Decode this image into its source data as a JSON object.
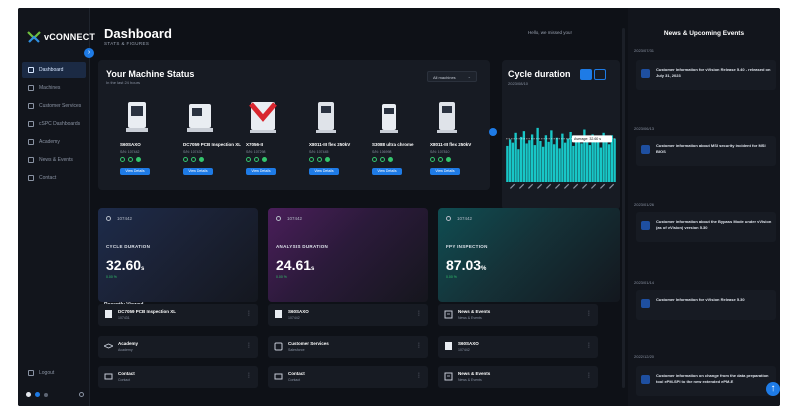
{
  "app": {
    "logo": "vCONNECT"
  },
  "header": {
    "title": "Dashboard",
    "subtitle": "STATS & FIGURES",
    "greeting": "Hello, we missed you!"
  },
  "sidebar": {
    "items": [
      {
        "label": "Dashboard",
        "icon": "grid-icon",
        "active": true
      },
      {
        "label": "Machines",
        "icon": "machine-icon"
      },
      {
        "label": "Customer Services",
        "icon": "service-icon"
      },
      {
        "label": "cSPC Dashboards",
        "icon": "chart-icon"
      },
      {
        "label": "Academy",
        "icon": "academy-icon"
      },
      {
        "label": "News & Events",
        "icon": "news-icon"
      },
      {
        "label": "Contact",
        "icon": "contact-icon"
      }
    ],
    "logout": "Logout"
  },
  "machine_status": {
    "title": "Your Machine Status",
    "subtitle": "In the last 24 hours",
    "filter": "All machines",
    "button_label": "View Details",
    "machines": [
      {
        "name": "S60SAXO",
        "sn": "S/N: 107442"
      },
      {
        "name": "DC7059 PCB Inspection XL",
        "sn": "S/N: 107431"
      },
      {
        "name": "X7056-II",
        "sn": "S/N: 107298"
      },
      {
        "name": "X8011-III flex 250kV",
        "sn": "S/N: 107445"
      },
      {
        "name": "S3088 ultra chrome",
        "sn": "S/N: 106998"
      },
      {
        "name": "X8011-III flex 250kV",
        "sn": "S/N: 107810"
      }
    ]
  },
  "cycle": {
    "title": "Cycle duration",
    "date": "2023/08/10",
    "chart_data": {
      "type": "bar",
      "values": [
        44,
        52,
        48,
        60,
        40,
        55,
        62,
        47,
        51,
        58,
        45,
        66,
        50,
        43,
        57,
        49,
        63,
        46,
        54,
        41,
        59,
        48,
        53,
        61,
        44,
        56,
        50,
        47,
        64,
        52,
        45,
        58,
        49,
        55,
        42,
        60,
        51,
        46,
        57,
        53
      ],
      "average_label": "Average: 32.60 s",
      "average_value": 32.6,
      "ylim": [
        0,
        100
      ]
    }
  },
  "kpis": [
    {
      "search": "107442",
      "label": "CYCLE DURATION",
      "value": "32.60",
      "unit": "s",
      "delta": "0.00 %"
    },
    {
      "search": "107442",
      "label": "ANALYSIS DURATION",
      "value": "24.61",
      "unit": "s",
      "delta": "0.00 %"
    },
    {
      "search": "107442",
      "label": "FPY INSPECTION",
      "value": "87.03",
      "unit": "%",
      "delta": "0.00 %"
    }
  ],
  "recent": {
    "title": "Recently Viewed",
    "items": [
      {
        "name": "DC7059 PCB Inspection XL",
        "sub": "107431",
        "icon": "machine-icon"
      },
      {
        "name": "S60SAXO",
        "sub": "107442",
        "icon": "machine-icon"
      },
      {
        "name": "News & Events",
        "sub": "News & Events",
        "icon": "news-icon"
      },
      {
        "name": "Academy",
        "sub": "Academy",
        "icon": "academy-icon"
      },
      {
        "name": "Customer Services",
        "sub": "Salesforce",
        "icon": "service-icon"
      },
      {
        "name": "S60SAXO",
        "sub": "107442",
        "icon": "machine-icon"
      },
      {
        "name": "Contact",
        "sub": "Contact",
        "icon": "contact-icon"
      },
      {
        "name": "Contact",
        "sub": "Contact",
        "icon": "contact-icon"
      },
      {
        "name": "News & Events",
        "sub": "News & Events",
        "icon": "news-icon"
      }
    ]
  },
  "news": {
    "title": "News & Upcoming Events",
    "items": [
      {
        "date": "2023/07/31",
        "text": "Customer Information for vVision Release 5.40 - released on July 31, 2023"
      },
      {
        "date": "2023/06/13",
        "text": "Customer information about MSI security incident for MSI BIOS"
      },
      {
        "date": "2023/01/26",
        "text": "Customer information about the Bypass Mode under vVision (as of vVision) version 5.30"
      },
      {
        "date": "2023/01/14",
        "text": "Customer Information for vVision Release 5.30"
      },
      {
        "date": "2022/12/20",
        "text": "Customer information on change from the data preparation tool ePM-SPI to the new extended ePM-E"
      }
    ]
  },
  "colors": {
    "accent": "#1e7be6",
    "bg": "#0e1117",
    "card": "#171b23",
    "positive": "#34c46d",
    "chart": "#18c7c7"
  }
}
